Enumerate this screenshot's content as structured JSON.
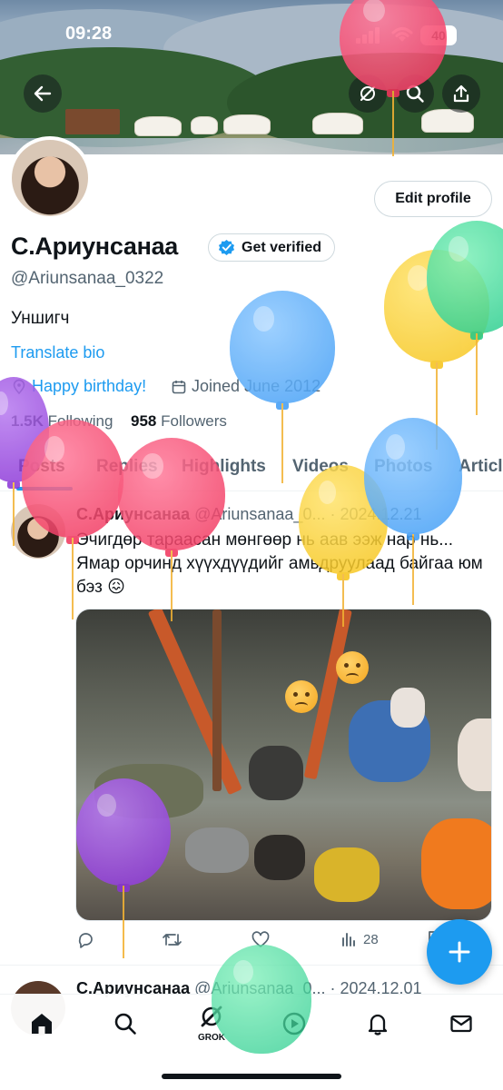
{
  "status_bar": {
    "time": "09:28",
    "battery": "40"
  },
  "profile": {
    "edit_label": "Edit profile",
    "name": "С.Ариунсанаа",
    "verified_label": "Get verified",
    "handle": "@Ariunsanaa_0322",
    "bio": "Уншигч",
    "translate_label": "Translate bio",
    "birthday": "Happy birthday!",
    "joined": "Joined June 2012",
    "following_count": "1.5K",
    "following_label": "Following",
    "followers_count": "958",
    "followers_label": "Followers"
  },
  "tabs": [
    "Posts",
    "Replies",
    "Highlights",
    "Videos",
    "Photos",
    "Articles"
  ],
  "post": {
    "author": "С.Ариунсанаа",
    "handle": "@Ariunsanaa_0...",
    "date": "· 2024.12.21",
    "text": "Эчигдөр тараасан мөнгөөр нь аав ээж нар нь... Ямар орчинд хүүхдүүдийг амьдруулаад байгаа юм бэз 😖",
    "views": "28"
  },
  "post2": {
    "author": "С.Ариунсанаа",
    "handle": "@Ariunsanaa_0...",
    "date": "· 2024.12.01"
  },
  "nav": {
    "grok_label": "GROK"
  },
  "colors": {
    "accent": "#1d9bf0",
    "text": "#0f1419",
    "muted": "#536471"
  },
  "icons": [
    "back-arrow-icon",
    "grok-icon",
    "search-icon",
    "share-icon",
    "verified-badge-icon",
    "location-icon",
    "calendar-icon",
    "reply-icon",
    "repost-icon",
    "like-icon",
    "views-icon",
    "bookmark-icon",
    "plus-icon",
    "home-icon",
    "search-icon",
    "grok-icon",
    "play-icon",
    "bell-icon",
    "mail-icon"
  ]
}
